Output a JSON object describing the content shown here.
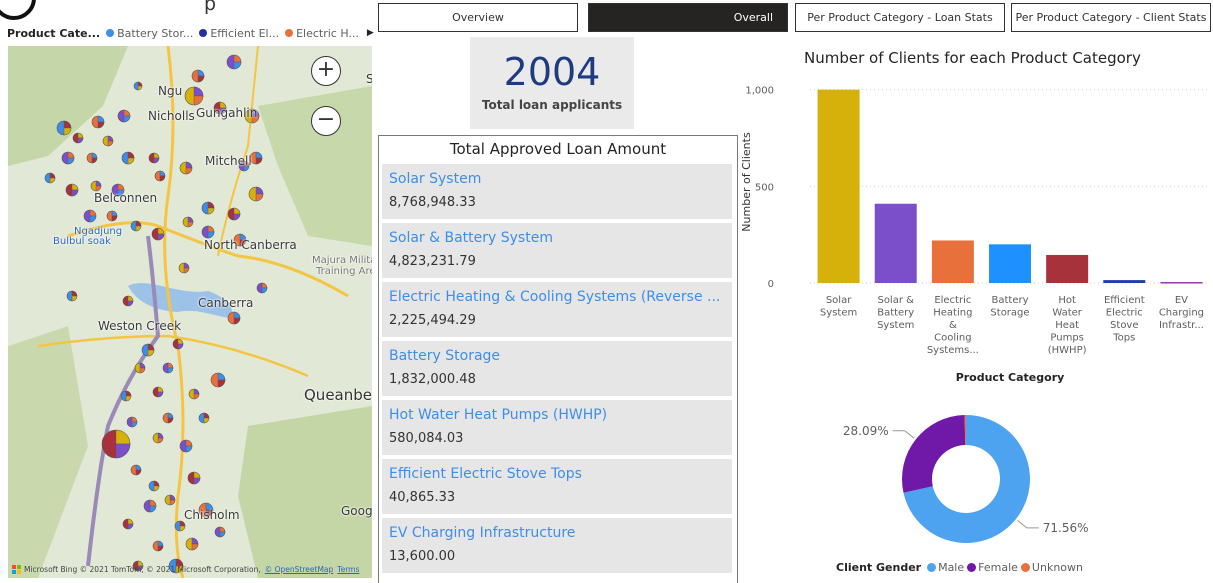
{
  "header": {
    "title_fragment": "p"
  },
  "map_legend": {
    "title": "Product Cate...",
    "items": [
      {
        "label": "Battery Stor...",
        "color": "#3d8ee8"
      },
      {
        "label": "Efficient El...",
        "color": "#2030a0"
      },
      {
        "label": "Electric H...",
        "color": "#e8703a"
      }
    ],
    "more_icon": "triangle-right-icon"
  },
  "map": {
    "labels": {
      "ngunnawal": "Ngu",
      "nicholls": "Nicholls",
      "gungahlin": "Gungahlin",
      "mitchell": "Mitchell",
      "belconnen": "Belconnen",
      "ngadjung": "Ngadjung",
      "bulbul_soak": "Bulbul soak",
      "north_canberra": "North Canberra",
      "majura": "Majura Milita",
      "majura2": "Training Are",
      "canberra": "Canberra",
      "weston_creek": "Weston Creek",
      "queanbeyan": "Queanbe",
      "google": "Goog",
      "chisholm": "Chisholm",
      "s_frag": "S"
    },
    "zoom_in": "+",
    "zoom_out": "−",
    "footer": {
      "bing": "Microsoft Bing",
      "copyright": "© 2021 TomTom, © 2021 Microsoft Corporation,",
      "osm": "© OpenStreetMap",
      "terms": "Terms"
    }
  },
  "tabs": [
    {
      "label": "Overview",
      "active": false
    },
    {
      "label": "Overall",
      "active": true
    },
    {
      "label": "Per Product Category - Loan Stats",
      "active": false
    },
    {
      "label": "Per Product Category - Client Stats",
      "active": false
    }
  ],
  "kpi": {
    "value": "2004",
    "label": "Total loan applicants"
  },
  "loans": {
    "title": "Total Approved Loan Amount",
    "items": [
      {
        "name": "Solar System",
        "amount": "8,768,948.33"
      },
      {
        "name": "Solar & Battery System",
        "amount": "4,823,231.79"
      },
      {
        "name": "Electric Heating & Cooling Systems (Reverse ...",
        "amount": "2,225,494.29"
      },
      {
        "name": "Battery Storage",
        "amount": "1,832,000.48"
      },
      {
        "name": "Hot Water Heat Pumps (HWHP)",
        "amount": "580,084.03"
      },
      {
        "name": "Efficient Electric Stove Tops",
        "amount": "40,865.33"
      },
      {
        "name": "EV Charging Infrastructure",
        "amount": "13,600.00"
      }
    ]
  },
  "chart_data": [
    {
      "type": "bar",
      "title": "Number of Clients for each Product Category",
      "xlabel": "Product Category",
      "ylabel": "Number of Clients",
      "ylim": [
        0,
        1050
      ],
      "yticks": [
        "0",
        "500",
        "1,000"
      ],
      "ytick_values": [
        0,
        500,
        1000
      ],
      "grid": true,
      "categories": [
        [
          "Solar",
          "System"
        ],
        [
          "Solar &",
          "Battery",
          "System"
        ],
        [
          "Electric",
          "Heating",
          "&",
          "Cooling",
          "Systems..."
        ],
        [
          "Battery",
          "Storage"
        ],
        [
          "Hot",
          "Water",
          "Heat",
          "Pumps",
          "(HWHP)"
        ],
        [
          "Efficient",
          "Electric",
          "Stove",
          "Tops"
        ],
        [
          "EV",
          "Charging",
          "Infrastr..."
        ]
      ],
      "values": [
        1000,
        410,
        220,
        200,
        145,
        15,
        5
      ],
      "colors": [
        "#d6b10a",
        "#7b4fc9",
        "#e8703a",
        "#1e90ff",
        "#a8323c",
        "#1f3fa8",
        "#9b30c0"
      ]
    },
    {
      "type": "pie",
      "variant": "donut",
      "legend_title": "Client Gender",
      "legend_position": "bottom",
      "slices": [
        {
          "name": "Male",
          "value": 71.56,
          "label": "71.56%",
          "color": "#4da3f0"
        },
        {
          "name": "Female",
          "value": 28.09,
          "label": "28.09%",
          "color": "#7018a8"
        },
        {
          "name": "Unknown",
          "value": 0.35,
          "label": "",
          "color": "#e8703a"
        }
      ]
    }
  ]
}
